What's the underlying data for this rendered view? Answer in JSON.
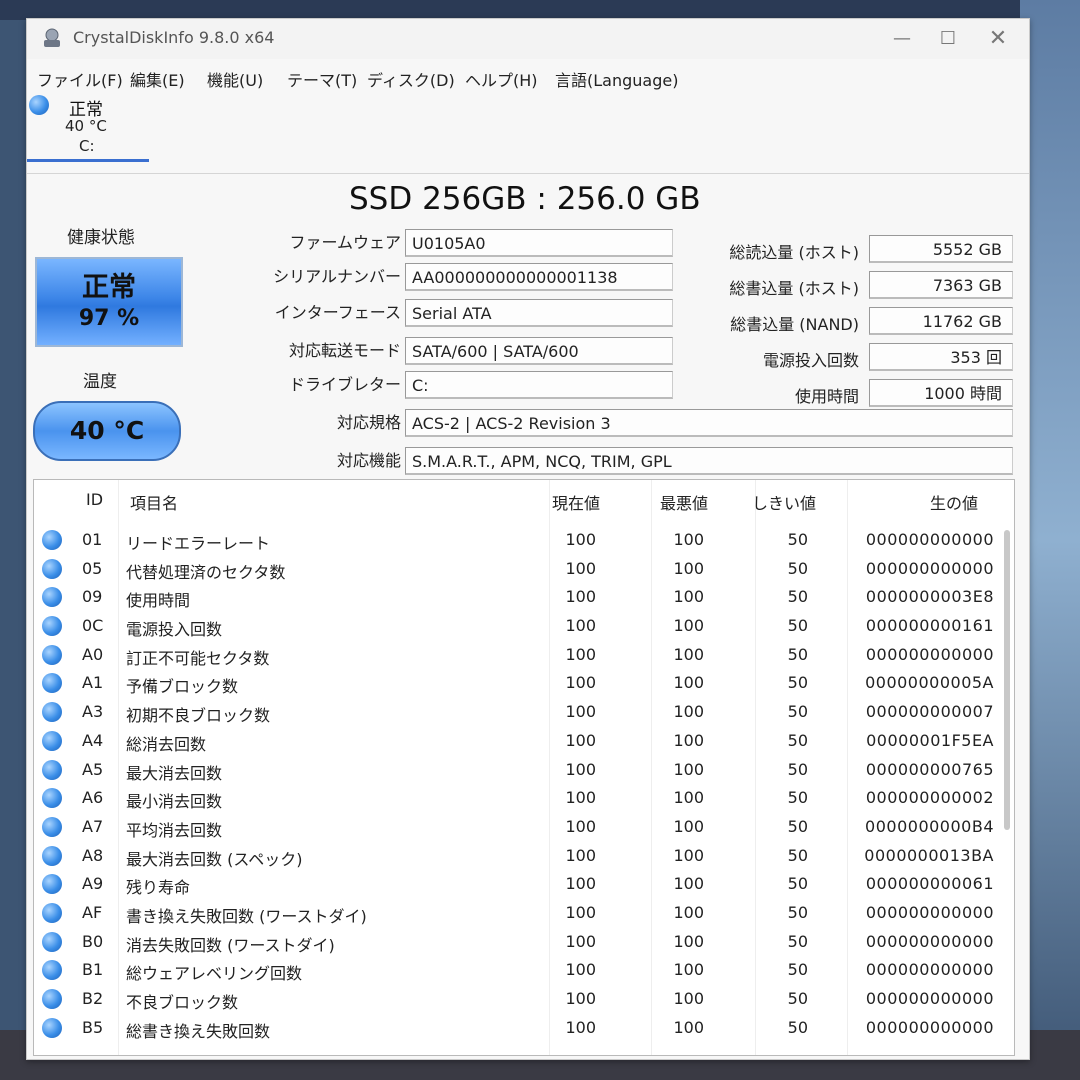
{
  "window": {
    "title": "CrystalDiskInfo 9.8.0 x64",
    "minimize": "—",
    "maximize": "☐",
    "close": "✕"
  },
  "menu": [
    "ファイル(F)",
    "編集(E)",
    "機能(U)",
    "テーマ(T)",
    "ディスク(D)",
    "ヘルプ(H)",
    "言語(Language)"
  ],
  "disk_tab": {
    "status": "正常",
    "temp": "40 °C",
    "letter": "C:"
  },
  "model": "SSD 256GB : 256.0 GB",
  "health": {
    "label": "健康状態",
    "status": "正常",
    "percent": "97 %",
    "color": "#3d86e8"
  },
  "temperature": {
    "label": "温度",
    "value": "40 °C"
  },
  "info": {
    "firmware": {
      "label": "ファームウェア",
      "value": "U0105A0"
    },
    "serial": {
      "label": "シリアルナンバー",
      "value": "AA000000000000001138"
    },
    "interface": {
      "label": "インターフェース",
      "value": "Serial ATA"
    },
    "transfer": {
      "label": "対応転送モード",
      "value": "SATA/600 | SATA/600"
    },
    "drive_letter": {
      "label": "ドライブレター",
      "value": "C:"
    },
    "standard": {
      "label": "対応規格",
      "value": "ACS-2 | ACS-2 Revision 3"
    },
    "features": {
      "label": "対応機能",
      "value": "S.M.A.R.T., APM, NCQ, TRIM, GPL"
    }
  },
  "stats": {
    "host_reads": {
      "label": "総読込量 (ホスト)",
      "value": "5552 GB"
    },
    "host_writes": {
      "label": "総書込量 (ホスト)",
      "value": "7363 GB"
    },
    "nand_writes": {
      "label": "総書込量 (NAND)",
      "value": "11762 GB"
    },
    "power_on_count": {
      "label": "電源投入回数",
      "value": "353 回"
    },
    "power_on_hours": {
      "label": "使用時間",
      "value": "1000 時間"
    }
  },
  "smart": {
    "headers": {
      "id": "ID",
      "name": "項目名",
      "current": "現在値",
      "worst": "最悪値",
      "threshold": "しきい値",
      "raw": "生の値"
    },
    "rows": [
      {
        "id": "01",
        "name": "リードエラーレート",
        "current": "100",
        "worst": "100",
        "threshold": "50",
        "raw": "000000000000"
      },
      {
        "id": "05",
        "name": "代替処理済のセクタ数",
        "current": "100",
        "worst": "100",
        "threshold": "50",
        "raw": "000000000000"
      },
      {
        "id": "09",
        "name": "使用時間",
        "current": "100",
        "worst": "100",
        "threshold": "50",
        "raw": "0000000003E8"
      },
      {
        "id": "0C",
        "name": "電源投入回数",
        "current": "100",
        "worst": "100",
        "threshold": "50",
        "raw": "000000000161"
      },
      {
        "id": "A0",
        "name": "訂正不可能セクタ数",
        "current": "100",
        "worst": "100",
        "threshold": "50",
        "raw": "000000000000"
      },
      {
        "id": "A1",
        "name": "予備ブロック数",
        "current": "100",
        "worst": "100",
        "threshold": "50",
        "raw": "00000000005A"
      },
      {
        "id": "A3",
        "name": "初期不良ブロック数",
        "current": "100",
        "worst": "100",
        "threshold": "50",
        "raw": "000000000007"
      },
      {
        "id": "A4",
        "name": "総消去回数",
        "current": "100",
        "worst": "100",
        "threshold": "50",
        "raw": "00000001F5EA"
      },
      {
        "id": "A5",
        "name": "最大消去回数",
        "current": "100",
        "worst": "100",
        "threshold": "50",
        "raw": "000000000765"
      },
      {
        "id": "A6",
        "name": "最小消去回数",
        "current": "100",
        "worst": "100",
        "threshold": "50",
        "raw": "000000000002"
      },
      {
        "id": "A7",
        "name": "平均消去回数",
        "current": "100",
        "worst": "100",
        "threshold": "50",
        "raw": "0000000000B4"
      },
      {
        "id": "A8",
        "name": "最大消去回数 (スペック)",
        "current": "100",
        "worst": "100",
        "threshold": "50",
        "raw": "0000000013BA"
      },
      {
        "id": "A9",
        "name": "残り寿命",
        "current": "100",
        "worst": "100",
        "threshold": "50",
        "raw": "000000000061"
      },
      {
        "id": "AF",
        "name": "書き換え失敗回数 (ワーストダイ)",
        "current": "100",
        "worst": "100",
        "threshold": "50",
        "raw": "000000000000"
      },
      {
        "id": "B0",
        "name": "消去失敗回数 (ワーストダイ)",
        "current": "100",
        "worst": "100",
        "threshold": "50",
        "raw": "000000000000"
      },
      {
        "id": "B1",
        "name": "総ウェアレベリング回数",
        "current": "100",
        "worst": "100",
        "threshold": "50",
        "raw": "000000000000"
      },
      {
        "id": "B2",
        "name": "不良ブロック数",
        "current": "100",
        "worst": "100",
        "threshold": "50",
        "raw": "000000000000"
      },
      {
        "id": "B5",
        "name": "総書き換え失敗回数",
        "current": "100",
        "worst": "100",
        "threshold": "50",
        "raw": "000000000000"
      }
    ]
  }
}
